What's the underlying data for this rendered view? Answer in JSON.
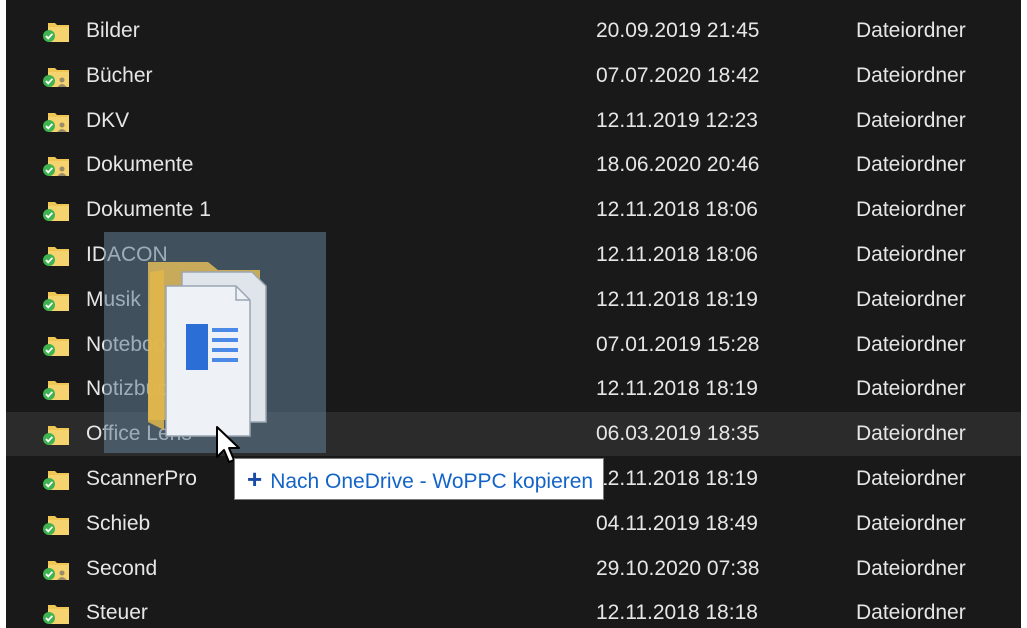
{
  "files": [
    {
      "name": "Bilder",
      "date": "20.09.2019 21:45",
      "type": "Dateiordner",
      "shared": false,
      "selected": false
    },
    {
      "name": "Bücher",
      "date": "07.07.2020 18:42",
      "type": "Dateiordner",
      "shared": true,
      "selected": false
    },
    {
      "name": "DKV",
      "date": "12.11.2019 12:23",
      "type": "Dateiordner",
      "shared": true,
      "selected": false
    },
    {
      "name": "Dokumente",
      "date": "18.06.2020 20:46",
      "type": "Dateiordner",
      "shared": true,
      "selected": false
    },
    {
      "name": "Dokumente 1",
      "date": "12.11.2018 18:06",
      "type": "Dateiordner",
      "shared": false,
      "selected": false
    },
    {
      "name": "IDACON",
      "date": "12.11.2018 18:06",
      "type": "Dateiordner",
      "shared": false,
      "selected": false
    },
    {
      "name": "Musik",
      "date": "12.11.2018 18:19",
      "type": "Dateiordner",
      "shared": false,
      "selected": false
    },
    {
      "name": "Notebooks",
      "date": "07.01.2019 15:28",
      "type": "Dateiordner",
      "shared": false,
      "selected": false
    },
    {
      "name": "Notizbücher",
      "date": "12.11.2018 18:19",
      "type": "Dateiordner",
      "shared": false,
      "selected": false
    },
    {
      "name": "Office Lens",
      "date": "06.03.2019 18:35",
      "type": "Dateiordner",
      "shared": false,
      "selected": true
    },
    {
      "name": "ScannerPro",
      "date": "12.11.2018 18:19",
      "type": "Dateiordner",
      "shared": false,
      "selected": false
    },
    {
      "name": "Schieb",
      "date": "04.11.2019 18:49",
      "type": "Dateiordner",
      "shared": false,
      "selected": false
    },
    {
      "name": "Second",
      "date": "29.10.2020 07:38",
      "type": "Dateiordner",
      "shared": true,
      "selected": false
    },
    {
      "name": "Steuer",
      "date": "12.11.2018 18:18",
      "type": "Dateiordner",
      "shared": false,
      "selected": false
    }
  ],
  "tooltip": {
    "plus": "+",
    "text": "Nach OneDrive - WoPPC kopieren"
  },
  "colors": {
    "background": "#191919",
    "text": "#e6e6e6",
    "selected_row": "#2b2b2b",
    "folder": "#f0c755",
    "sync_check": "#3fb34f",
    "tooltip_text": "#1464c8"
  },
  "icons": {
    "folder": "folder-icon",
    "sync_status": "check-circle-icon",
    "shared": "people-icon",
    "dragged_word_doc": "word-document-icon",
    "cursor": "mouse-pointer-icon"
  }
}
